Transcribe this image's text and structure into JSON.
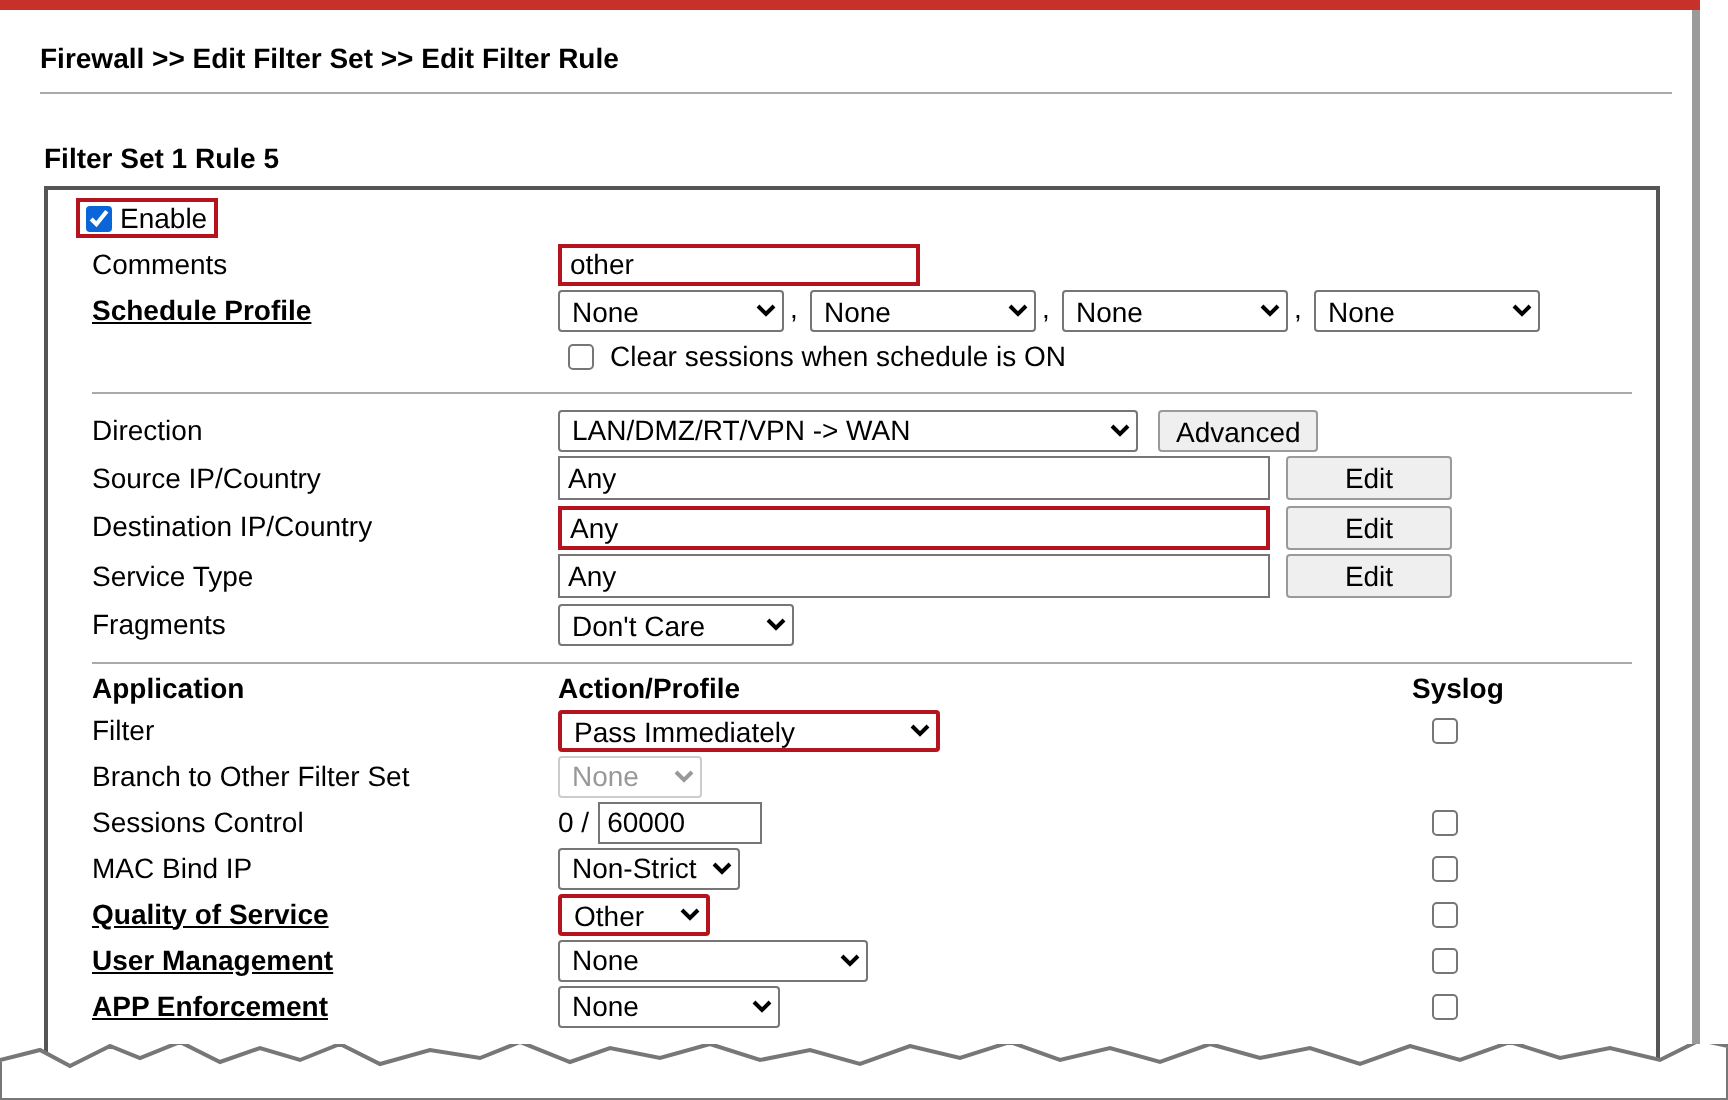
{
  "breadcrumb": "Firewall >> Edit Filter Set >> Edit Filter Rule",
  "section_title": "Filter Set 1 Rule 5",
  "enable": {
    "label": "Enable",
    "checked": true,
    "highlighted": true
  },
  "comments": {
    "label": "Comments",
    "value": "other",
    "highlighted": true
  },
  "schedule_profile": {
    "label": "Schedule Profile",
    "selects": [
      "None",
      "None",
      "None",
      "None"
    ],
    "separator": ",",
    "clear_sessions": {
      "label": "Clear sessions when schedule is ON",
      "checked": false
    }
  },
  "rule_rows": [
    {
      "kind": "select",
      "label": "Direction",
      "value": "LAN/DMZ/RT/VPN -> WAN",
      "button": "Advanced",
      "highlighted": false
    },
    {
      "kind": "text_edit",
      "label": "Source IP/Country",
      "value": "Any",
      "button": "Edit",
      "highlighted": false
    },
    {
      "kind": "text_edit",
      "label": "Destination IP/Country",
      "value": "Any",
      "button": "Edit",
      "highlighted": true
    },
    {
      "kind": "text_edit",
      "label": "Service Type",
      "value": "Any",
      "button": "Edit",
      "highlighted": false
    },
    {
      "kind": "select",
      "label": "Fragments",
      "value": "Don't Care",
      "highlighted": false
    }
  ],
  "application_table": {
    "columns": [
      "Application",
      "Action/Profile",
      "Syslog"
    ],
    "rows": [
      {
        "kind": "select",
        "label": "Filter",
        "link": false,
        "value": "Pass Immediately",
        "highlighted": true,
        "disabled": false,
        "syslog_checked": false
      },
      {
        "kind": "select",
        "label": "Branch to Other Filter Set",
        "link": false,
        "value": "None",
        "highlighted": false,
        "disabled": true
      },
      {
        "kind": "sessions",
        "label": "Sessions Control",
        "link": false,
        "prefix": "0 /",
        "value": "60000",
        "syslog_checked": false
      },
      {
        "kind": "select",
        "label": "MAC Bind IP",
        "link": false,
        "value": "Non-Strict",
        "highlighted": false,
        "disabled": false,
        "syslog_checked": false
      },
      {
        "kind": "select",
        "label": "Quality of Service",
        "link": true,
        "value": "Other",
        "highlighted": true,
        "disabled": false,
        "syslog_checked": false
      },
      {
        "kind": "select",
        "label": "User Management",
        "link": true,
        "value": "None",
        "highlighted": false,
        "disabled": false,
        "syslog_checked": false
      },
      {
        "kind": "select",
        "label": "APP Enforcement",
        "link": true,
        "value": "None",
        "highlighted": false,
        "disabled": false,
        "syslog_checked": false
      }
    ]
  }
}
